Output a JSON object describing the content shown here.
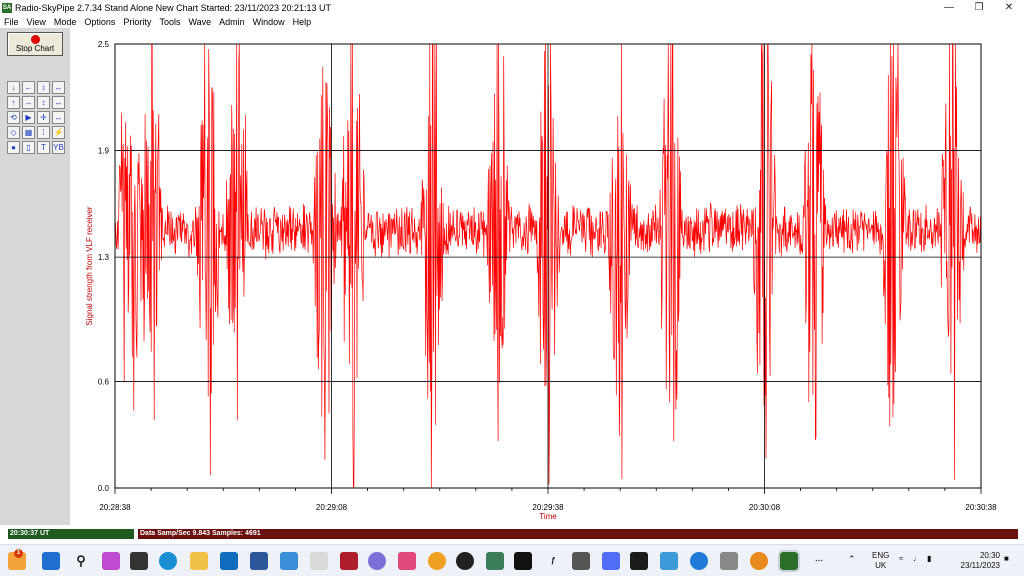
{
  "title_bar": {
    "app_icon_text": "SA",
    "title": "Radio-SkyPipe  2.7.34  Stand Alone  New Chart Started: 23/11/2023 20:21:13 UT"
  },
  "menu": [
    "File",
    "View",
    "Mode",
    "Options",
    "Priority",
    "Tools",
    "Wave",
    "Admin",
    "Window",
    "Help"
  ],
  "toolbar": {
    "stop_label": "Stop Chart",
    "tools": [
      "↓",
      "←",
      "↕",
      "↔",
      "↑",
      "→",
      "↕",
      "↔",
      "⟲",
      "▶",
      "✛",
      "↔",
      "◇",
      "▦",
      "⁞",
      "⚡",
      "●",
      "▯",
      "T",
      "YB"
    ]
  },
  "status": {
    "time": "20:30:37 UT",
    "info": "Data Samp/Sec 9.843   Samples: 4691"
  },
  "taskbar": {
    "lang_top": "ENG",
    "lang_bottom": "UK",
    "time": "20:30",
    "date": "23/11/2023",
    "notification_count": "1"
  },
  "colors": {
    "signal": "#ff0000",
    "axis_label": "#c00000",
    "grid": "#000000",
    "status_time_bg": "#1f5b1f",
    "status_info_bg": "#6a0f0f"
  },
  "chart_data": {
    "type": "line",
    "xlabel": "Time",
    "ylabel": "Signal strength from VLF receiver",
    "x_ticks": [
      "20:28:38",
      "20:29:08",
      "20:29:38",
      "20:30:08",
      "20:30:38"
    ],
    "y_ticks": [
      0.0,
      0.6,
      1.3,
      1.9,
      2.5
    ],
    "y_tick_labels": [
      "0.0",
      "0.6",
      "1.3",
      "1.9",
      "2.5"
    ],
    "ylim": [
      0.0,
      2.5
    ],
    "grid": true,
    "series": [
      {
        "baseline": 1.45,
        "noise": 0.12,
        "burst_times_s": [
          2,
          5,
          13,
          17,
          29,
          33,
          44,
          53,
          60,
          70,
          77,
          90,
          97,
          108,
          116
        ],
        "y_min": 0.0,
        "y_max": 2.5
      }
    ]
  }
}
